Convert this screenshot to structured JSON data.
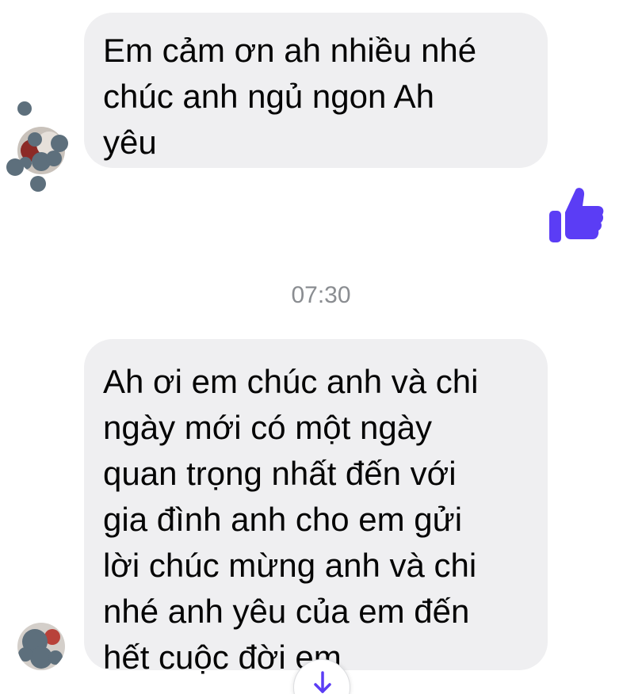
{
  "messages": [
    {
      "sender": "contact",
      "text": "Em cảm ơn ah nhiều nhé\nchúc anh ngủ ngon Ah\nyêu"
    },
    {
      "sender": "self",
      "reaction": "like-icon"
    },
    {
      "sender": "contact",
      "text": "Ah ơi em chúc anh và chi\nngày mới có một ngày\nquan trọng nhất đến với\ngia đình anh cho em gửi\nlời chúc mừng anh và chi\nnhé anh yêu của em đến\nhết cuộc đời em"
    }
  ],
  "timestamp": "07:30",
  "colors": {
    "bubble_background": "#efeff1",
    "like_icon": "#5b3df5",
    "timestamp_text": "#8a8d91",
    "scroll_arrow": "#5b3df5"
  },
  "icons": {
    "like": "like-icon",
    "scroll_down": "arrow-down-icon"
  }
}
